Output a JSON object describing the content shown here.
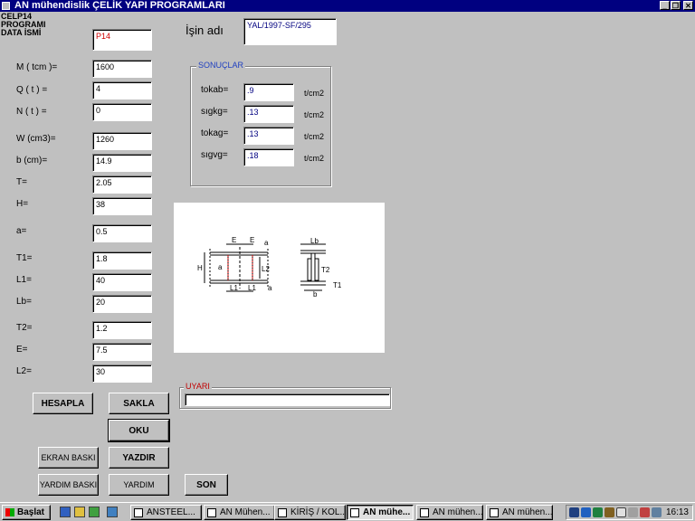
{
  "window": {
    "title": "AN mühendislik  ÇELİK YAPI PROGRAMLARI",
    "min_glyph": "_",
    "max_glyph": "❐",
    "close_glyph": "✕"
  },
  "header": {
    "line1": "CELP14",
    "line2": "PROGRAMI",
    "line3": "DATA  İSMİ",
    "data_name_value": "P14"
  },
  "job": {
    "label": "İşin adı",
    "value": "YAL/1997-SF/295"
  },
  "inputs": [
    {
      "label": "M ( tcm )=",
      "value": "1600"
    },
    {
      "label": "Q ( t ) =",
      "value": "4"
    },
    {
      "label": "N ( t ) =",
      "value": "0"
    },
    {
      "label": "W (cm3)=",
      "value": "1260"
    },
    {
      "label": "b (cm)=",
      "value": "14.9"
    },
    {
      "label": "T=",
      "value": "2.05"
    },
    {
      "label": "H=",
      "value": "38"
    },
    {
      "label": "a=",
      "value": "0.5"
    },
    {
      "label": "T1=",
      "value": "1.8"
    },
    {
      "label": "L1=",
      "value": "40"
    },
    {
      "label": "Lb=",
      "value": "20"
    },
    {
      "label": "T2=",
      "value": "1.2"
    },
    {
      "label": "E=",
      "value": "7.5"
    },
    {
      "label": "L2=",
      "value": "30"
    }
  ],
  "results": {
    "title": "SONUÇLAR",
    "rows": [
      {
        "label": "tokab=",
        "value": ".9",
        "unit": "t/cm2"
      },
      {
        "label": "sıgkg=",
        "value": ".13",
        "unit": "t/cm2"
      },
      {
        "label": "tokag=",
        "value": ".13",
        "unit": "t/cm2"
      },
      {
        "label": "sıgvg=",
        "value": ".18",
        "unit": "t/cm2"
      }
    ]
  },
  "warning": {
    "title": "UYARI",
    "value": ""
  },
  "diagram": {
    "E1": "E",
    "E2": "E",
    "a_top": "a",
    "H": "H",
    "a_left": "a",
    "L2": "L2",
    "L1a": "L1",
    "L1b": "L1",
    "a_bot": "a",
    "Lb": "Lb",
    "T2": "T2",
    "b": "b",
    "T1": "T1"
  },
  "buttons": {
    "hesapla": "HESAPLA",
    "sakla": "SAKLA",
    "oku": "OKU",
    "ekran_baski": "EKRAN BASKI",
    "yazdir": "YAZDIR",
    "yardim_baski": "YARDIM BASKI",
    "yardim": "YARDIM",
    "son": "SON"
  },
  "taskbar": {
    "start": "Başlat",
    "tasks": [
      {
        "label": "ANSTEEL..."
      },
      {
        "label": "AN Mühen..."
      },
      {
        "label": "KİRİŞ / KOL..."
      },
      {
        "label": "AN mühe...",
        "active": true
      },
      {
        "label": "AN mühen..."
      },
      {
        "label": "AN mühen..."
      },
      {
        "label": "AN mühen..."
      }
    ],
    "clock": "16:13"
  }
}
